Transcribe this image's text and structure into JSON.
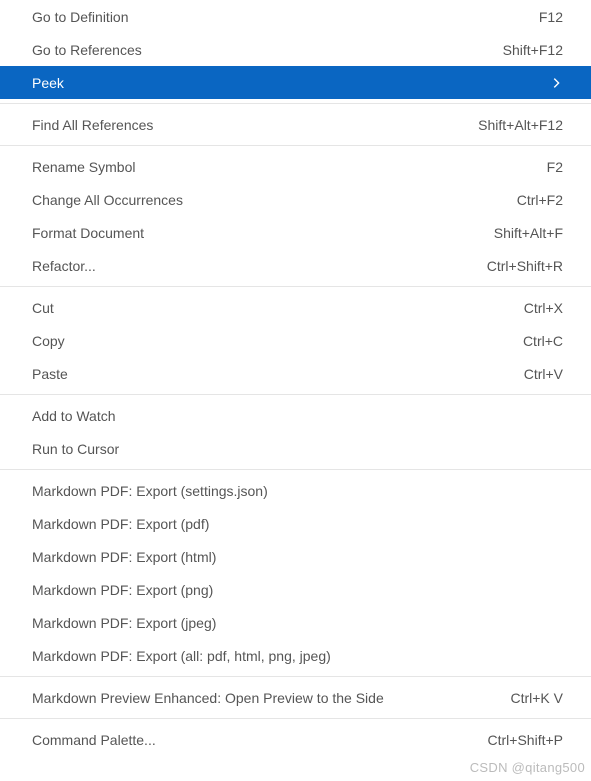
{
  "menu": {
    "groups": [
      [
        {
          "label": "Go to Definition",
          "shortcut": "F12",
          "selected": false,
          "submenu": false
        },
        {
          "label": "Go to References",
          "shortcut": "Shift+F12",
          "selected": false,
          "submenu": false
        },
        {
          "label": "Peek",
          "shortcut": "",
          "selected": true,
          "submenu": true
        }
      ],
      [
        {
          "label": "Find All References",
          "shortcut": "Shift+Alt+F12",
          "selected": false,
          "submenu": false
        }
      ],
      [
        {
          "label": "Rename Symbol",
          "shortcut": "F2",
          "selected": false,
          "submenu": false
        },
        {
          "label": "Change All Occurrences",
          "shortcut": "Ctrl+F2",
          "selected": false,
          "submenu": false
        },
        {
          "label": "Format Document",
          "shortcut": "Shift+Alt+F",
          "selected": false,
          "submenu": false
        },
        {
          "label": "Refactor...",
          "shortcut": "Ctrl+Shift+R",
          "selected": false,
          "submenu": false
        }
      ],
      [
        {
          "label": "Cut",
          "shortcut": "Ctrl+X",
          "selected": false,
          "submenu": false
        },
        {
          "label": "Copy",
          "shortcut": "Ctrl+C",
          "selected": false,
          "submenu": false
        },
        {
          "label": "Paste",
          "shortcut": "Ctrl+V",
          "selected": false,
          "submenu": false
        }
      ],
      [
        {
          "label": "Add to Watch",
          "shortcut": "",
          "selected": false,
          "submenu": false
        },
        {
          "label": "Run to Cursor",
          "shortcut": "",
          "selected": false,
          "submenu": false
        }
      ],
      [
        {
          "label": "Markdown PDF: Export (settings.json)",
          "shortcut": "",
          "selected": false,
          "submenu": false
        },
        {
          "label": "Markdown PDF: Export (pdf)",
          "shortcut": "",
          "selected": false,
          "submenu": false
        },
        {
          "label": "Markdown PDF: Export (html)",
          "shortcut": "",
          "selected": false,
          "submenu": false
        },
        {
          "label": "Markdown PDF: Export (png)",
          "shortcut": "",
          "selected": false,
          "submenu": false
        },
        {
          "label": "Markdown PDF: Export (jpeg)",
          "shortcut": "",
          "selected": false,
          "submenu": false
        },
        {
          "label": "Markdown PDF: Export (all: pdf, html, png, jpeg)",
          "shortcut": "",
          "selected": false,
          "submenu": false
        }
      ],
      [
        {
          "label": "Markdown Preview Enhanced: Open Preview to the Side",
          "shortcut": "Ctrl+K V",
          "selected": false,
          "submenu": false
        }
      ],
      [
        {
          "label": "Command Palette...",
          "shortcut": "Ctrl+Shift+P",
          "selected": false,
          "submenu": false
        }
      ]
    ]
  },
  "watermark": "CSDN @qitang500",
  "colors": {
    "selection": "#0a66c2",
    "text": "#555555",
    "separator": "#e5e5e5"
  }
}
